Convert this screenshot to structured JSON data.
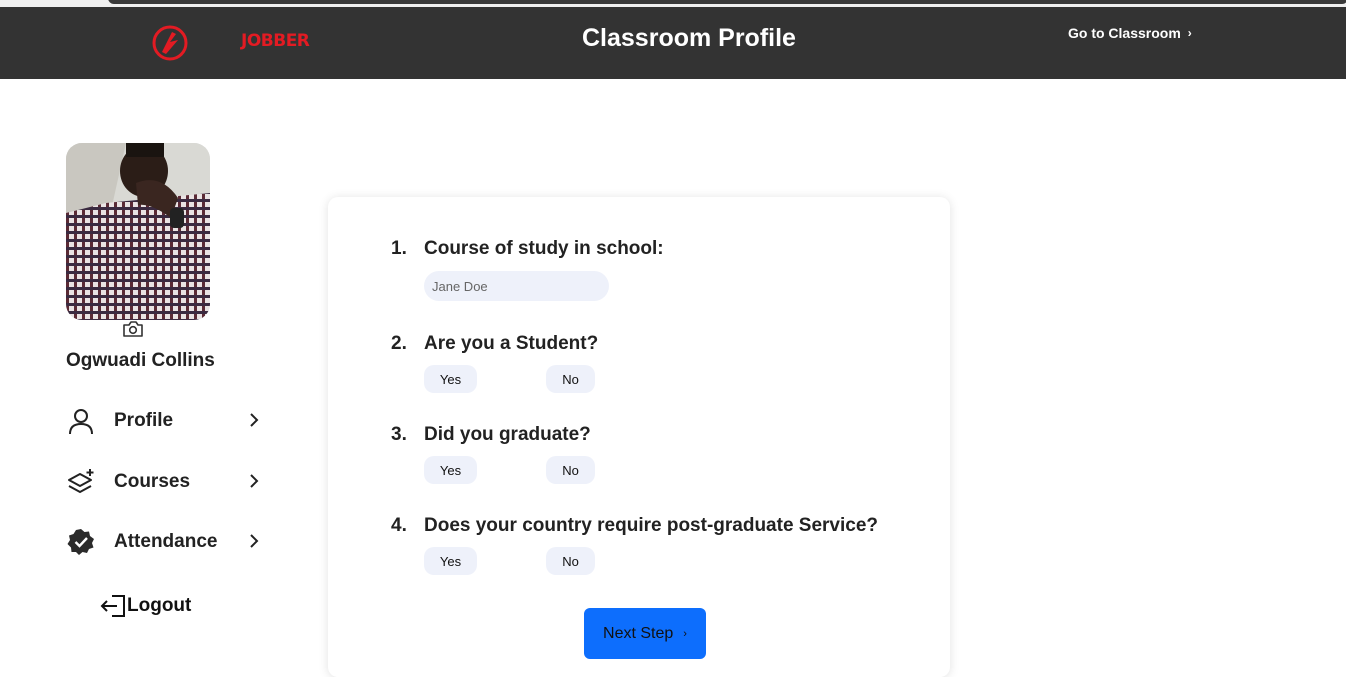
{
  "header": {
    "brand": "JOBBER",
    "title": "Classroom Profile",
    "go_link": "Go to Classroom",
    "go_chevron": "›",
    "brand_color": "#e31b23",
    "bg_color": "#333333"
  },
  "sidebar": {
    "user_name": "Ogwuadi Collins",
    "items": [
      {
        "label": "Profile",
        "icon": "person-icon"
      },
      {
        "label": "Courses",
        "icon": "layers-plus-icon"
      },
      {
        "label": "Attendance",
        "icon": "verified-badge-icon"
      }
    ],
    "logout": "Logout"
  },
  "form": {
    "questions": [
      {
        "num": "1.",
        "text": "Course of study in school:"
      },
      {
        "num": "2.",
        "text": "Are you a Student?"
      },
      {
        "num": "3.",
        "text": "Did you graduate?"
      },
      {
        "num": "4.",
        "text": "Does your country require post-graduate Service?"
      }
    ],
    "course_placeholder": "Jane Doe",
    "yes": "Yes",
    "no": "No",
    "next": "Next Step",
    "next_chevron": "›",
    "accent_color": "#0d6efd"
  }
}
